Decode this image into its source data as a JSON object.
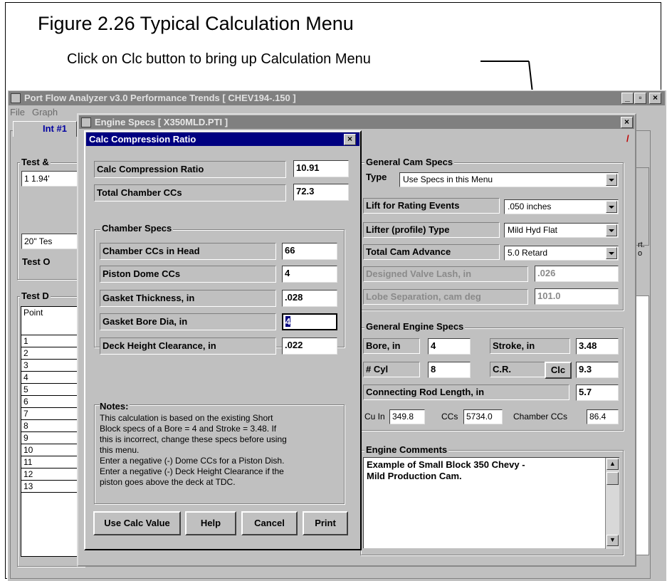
{
  "figure": {
    "title": "Figure 2.26 Typical Calculation Menu",
    "caption": "Click on Clc button to bring up Calculation Menu"
  },
  "app": {
    "title": "Port Flow Analyzer v3.0   Performance Trends   [ CHEV194-.150 ]",
    "menu": [
      "File",
      "Graph"
    ],
    "tab": "Int #1",
    "left_labels": {
      "test_group": "Test &",
      "test_field": "1  1.94'",
      "test_desc": "20\" Tes",
      "test_other": "Test O",
      "data_group": "Test D",
      "point_header": "Point"
    },
    "rows": [
      "1",
      "2",
      "3",
      "4",
      "5",
      "6",
      "7",
      "8",
      "9",
      "10",
      "11",
      "12",
      "13"
    ],
    "right_fragment": "rt.\no",
    "right_digit": "6"
  },
  "engine_specs": {
    "title": "Engine Specs   [ X350MLD.PTI ]",
    "cam": {
      "group": "General Cam Specs",
      "type_label": "Type",
      "type_value": "Use Specs in this Menu",
      "lift_label": "Lift for Rating Events",
      "lift_value": ".050 inches",
      "lifter_label": "Lifter (profile) Type",
      "lifter_value": "Mild Hyd Flat",
      "advance_label": "Total Cam Advance",
      "advance_value": "5.0 Retard",
      "lash_label": "Designed Valve Lash, in",
      "lash_value": ".026",
      "lobe_label": "Lobe Separation, cam deg",
      "lobe_value": "101.0"
    },
    "engine": {
      "group": "General Engine Specs",
      "bore_label": "Bore, in",
      "bore_value": "4",
      "stroke_label": "Stroke, in",
      "stroke_value": "3.48",
      "cyl_label": "# Cyl",
      "cyl_value": "8",
      "cr_label": "C.R.",
      "clc_label": "Clc",
      "cr_value": "9.3",
      "rod_label": "Connecting Rod Length, in",
      "rod_value": "5.7",
      "cuin_label": "Cu In",
      "cuin_value": "349.8",
      "ccs_label": "CCs",
      "ccs_value": "5734.0",
      "chamber_label": "Chamber CCs",
      "chamber_value": "86.4"
    },
    "comments": {
      "group": "Engine Comments",
      "text": "Example of Small Block 350 Chevy -\nMild Production Cam."
    }
  },
  "calc": {
    "title": "Calc Compression Ratio",
    "cr_label": "Calc Compression Ratio",
    "cr_value": "10.91",
    "total_label": "Total Chamber CCs",
    "total_value": "72.3",
    "chamber_group": "Chamber Specs",
    "fields": [
      {
        "label": "Chamber CCs in Head",
        "value": "66"
      },
      {
        "label": "Piston Dome CCs",
        "value": "4"
      },
      {
        "label": "Gasket Thickness, in",
        "value": ".028"
      },
      {
        "label": "Gasket Bore Dia, in",
        "value": "4"
      },
      {
        "label": "Deck Height Clearance, in",
        "value": ".022"
      }
    ],
    "notes_title": "Notes:",
    "notes": [
      "This calculation is based on the existing Short",
      "Block specs of a Bore =  4 and Stroke = 3.48.  If",
      "this is incorrect, change these specs before using",
      "this menu.",
      "Enter a negative (-) Dome CCs for a Piston Dish.",
      "Enter a negative (-) Deck Height Clearance if the",
      "piston goes above the deck at TDC."
    ],
    "buttons": {
      "use": "Use Calc Value",
      "help": "Help",
      "cancel": "Cancel",
      "print": "Print"
    }
  }
}
